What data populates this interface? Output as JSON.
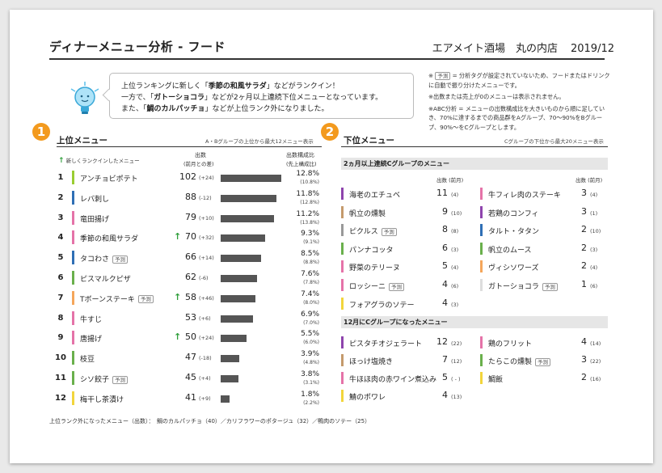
{
  "header": {
    "title": "ディナーメニュー分析 - フード",
    "shop": "エアメイト酒場　丸の内店",
    "period": "2019/12"
  },
  "bubble": {
    "line1_pre": "上位ランキングに新しく「",
    "line1_bold": "季節の和風サラダ",
    "line1_post": "」などがランクイン！",
    "line2_pre": "一方で、「",
    "line2_bold": "ガトーショコラ",
    "line2_post": "」などが2ヶ月以上連続下位メニューとなっています。",
    "line3_pre": "また、「",
    "line3_bold": "鯛のカルパッチョ",
    "line3_post": "」などが上位ランク外になりました。"
  },
  "notes": {
    "note1_pre": "※ ",
    "note1_tag": "予測",
    "note1_post": " = 分析タグが設定されていないため、フードまたはドリンクに自動で振り分けたメニューです。",
    "note2": "※出数または売上が0のメニューは表示されません。",
    "note3": "※ABC分析 = メニューの出数構成比を大きいものから順に足していき、70%に達するまでの商品群をAグループ、70〜90%をBグループ、90%〜をCグループとします。"
  },
  "upper": {
    "badge": "1",
    "title": "上位メニュー",
    "note": "A・Bグループの上位から最大12メニュー表示",
    "new_label": "新しくランクインしたメニュー",
    "count_header": "出数",
    "count_sub": "(前月との差)",
    "ratio_header": "出数構成比",
    "ratio_sub": "(先上構成比)",
    "tag": "予測",
    "items": [
      {
        "rank": "1",
        "name": "アンチョビポテト",
        "color": "#9acd32",
        "new": false,
        "tag": false,
        "count": "102",
        "diff": "(+24)",
        "pct": "12.8%",
        "sub": "(10.8%)",
        "value": 12.8
      },
      {
        "rank": "2",
        "name": "レバ刺し",
        "color": "#2f6fb5",
        "new": false,
        "tag": false,
        "count": "88",
        "diff": "(-12)",
        "pct": "11.8%",
        "sub": "(12.8%)",
        "value": 11.8
      },
      {
        "rank": "3",
        "name": "竜田揚げ",
        "color": "#e573a8",
        "new": false,
        "tag": false,
        "count": "79",
        "diff": "(+10)",
        "pct": "11.2%",
        "sub": "(13.8%)",
        "value": 11.2
      },
      {
        "rank": "4",
        "name": "季節の和風サラダ",
        "color": "#e573a8",
        "new": true,
        "tag": false,
        "count": "70",
        "diff": "(+32)",
        "pct": "9.3%",
        "sub": "(9.1%)",
        "value": 9.3
      },
      {
        "rank": "5",
        "name": "タコわさ",
        "color": "#2f6fb5",
        "new": false,
        "tag": true,
        "count": "66",
        "diff": "(+14)",
        "pct": "8.5%",
        "sub": "(8.8%)",
        "value": 8.5
      },
      {
        "rank": "6",
        "name": "ピスマルクピザ",
        "color": "#6ab04c",
        "new": false,
        "tag": false,
        "count": "62",
        "diff": "(-6)",
        "pct": "7.6%",
        "sub": "(7.8%)",
        "value": 7.6
      },
      {
        "rank": "7",
        "name": "Tボーンステーキ",
        "color": "#f5a65b",
        "new": true,
        "tag": true,
        "count": "58",
        "diff": "(+46)",
        "pct": "7.4%",
        "sub": "(8.0%)",
        "value": 7.4
      },
      {
        "rank": "8",
        "name": "牛すじ",
        "color": "#e573a8",
        "new": false,
        "tag": false,
        "count": "53",
        "diff": "(+6)",
        "pct": "6.9%",
        "sub": "(7.0%)",
        "value": 6.9
      },
      {
        "rank": "9",
        "name": "唐揚げ",
        "color": "#e573a8",
        "new": true,
        "tag": false,
        "count": "50",
        "diff": "(+24)",
        "pct": "5.5%",
        "sub": "(6.0%)",
        "value": 5.5
      },
      {
        "rank": "10",
        "name": "枝豆",
        "color": "#6ab04c",
        "new": false,
        "tag": false,
        "count": "47",
        "diff": "(-18)",
        "pct": "3.9%",
        "sub": "(4.8%)",
        "value": 3.9
      },
      {
        "rank": "11",
        "name": "シソ餃子",
        "color": "#6ab04c",
        "new": false,
        "tag": true,
        "count": "45",
        "diff": "(+4)",
        "pct": "3.8%",
        "sub": "(3.1%)",
        "value": 3.8
      },
      {
        "rank": "12",
        "name": "梅干し茶漬け",
        "color": "#f2d53c",
        "new": false,
        "tag": false,
        "count": "41",
        "diff": "(+9)",
        "pct": "1.8%",
        "sub": "(2.2%)",
        "value": 1.8
      }
    ]
  },
  "lower": {
    "badge": "2",
    "title": "下位メニュー",
    "note": "Cグループの下位から最大20メニュー表示",
    "group1": "2ヵ月以上連続Cグループのメニュー",
    "count_header": "出数",
    "count_sub": "(前月)",
    "left": [
      {
        "name": "海老のエチュベ",
        "color": "#8e44ad",
        "tag": false,
        "count": "11",
        "prev": "(4)"
      },
      {
        "name": "帆立の燻製",
        "color": "#c49a6c",
        "tag": false,
        "count": "9",
        "prev": "(10)"
      },
      {
        "name": "ピクルス",
        "color": "#999999",
        "tag": true,
        "count": "8",
        "prev": "(8)"
      },
      {
        "name": "パンナコッタ",
        "color": "#6ab04c",
        "tag": false,
        "count": "6",
        "prev": "(3)"
      },
      {
        "name": "野菜のテリーヌ",
        "color": "#e573a8",
        "tag": false,
        "count": "5",
        "prev": "(4)"
      },
      {
        "name": "ロッシーニ",
        "color": "#e573a8",
        "tag": true,
        "count": "4",
        "prev": "(6)"
      },
      {
        "name": "フォアグラのソテー",
        "color": "#f2d53c",
        "tag": false,
        "count": "4",
        "prev": "(3)"
      }
    ],
    "right": [
      {
        "name": "牛フィレ肉のステーキ",
        "color": "#e573a8",
        "tag": false,
        "count": "3",
        "prev": "(4)"
      },
      {
        "name": "若鶏のコンフィ",
        "color": "#8e44ad",
        "tag": false,
        "count": "3",
        "prev": "(1)"
      },
      {
        "name": "タルト・タタン",
        "color": "#2f6fb5",
        "tag": false,
        "count": "2",
        "prev": "(10)"
      },
      {
        "name": "帆立のムース",
        "color": "#6ab04c",
        "tag": false,
        "count": "2",
        "prev": "(3)"
      },
      {
        "name": "ヴィシソワーズ",
        "color": "#f5a65b",
        "tag": false,
        "count": "2",
        "prev": "(4)"
      },
      {
        "name": "ガトーショコラ",
        "color": "#dddddd",
        "tag": true,
        "count": "1",
        "prev": "(6)"
      }
    ],
    "group2": "12月にCグループになったメニュー",
    "left2": [
      {
        "name": "ピスタチオジェラート",
        "color": "#8e44ad",
        "tag": false,
        "count": "12",
        "prev": "(22)"
      },
      {
        "name": "ほっけ塩焼き",
        "color": "#c49a6c",
        "tag": false,
        "count": "7",
        "prev": "(12)"
      },
      {
        "name": "牛ほほ肉の赤ワイン煮込み",
        "color": "#e573a8",
        "tag": false,
        "count": "5",
        "prev": "( - )"
      },
      {
        "name": "鯖のポワレ",
        "color": "#f2d53c",
        "tag": false,
        "count": "4",
        "prev": "(13)"
      }
    ],
    "right2": [
      {
        "name": "鶏のフリット",
        "color": "#e573a8",
        "tag": false,
        "count": "4",
        "prev": "(14)"
      },
      {
        "name": "たらこの燻製",
        "color": "#6ab04c",
        "tag": true,
        "count": "3",
        "prev": "(22)"
      },
      {
        "name": "鯛飯",
        "color": "#f2d53c",
        "tag": false,
        "count": "2",
        "prev": "(16)"
      }
    ],
    "tag": "予測"
  },
  "footer": {
    "text": "上位ランク外になったメニュー（出数）：　鯛のカルパッチョ（40）／カリフラワーのポタージュ（32）／鴨肉のソテー（25）"
  }
}
